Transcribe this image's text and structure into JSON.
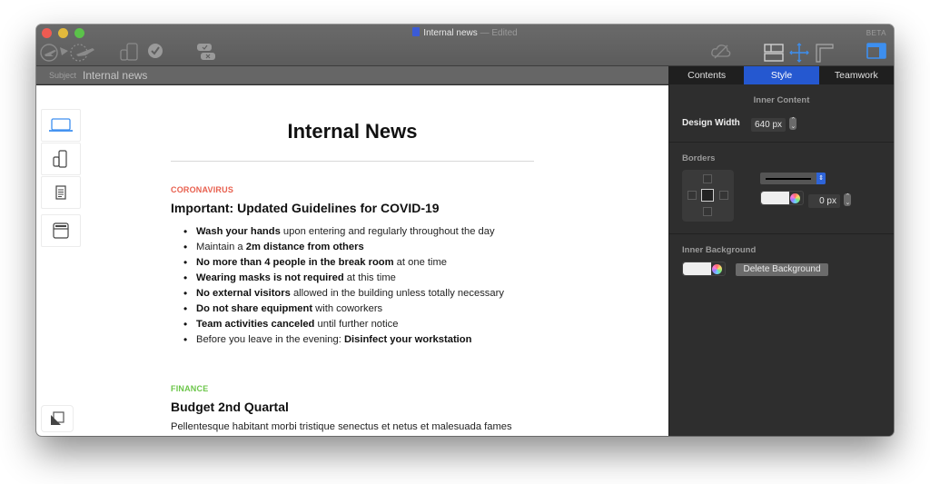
{
  "window": {
    "title": "Internal news",
    "title_status": "— Edited",
    "beta_label": "BETA"
  },
  "toolbar": {
    "left_icons": [
      "send-plane-icon",
      "schedule-plane-icon",
      "device-preview-icon",
      "check-icon",
      "approve-reject-icon"
    ],
    "right_icons": [
      "cloud-off-icon",
      "layout-blocks-icon",
      "move-icon",
      "ruler-icon",
      "sidebar-panel-icon"
    ]
  },
  "subject": {
    "label": "Subject",
    "value": "Internal news"
  },
  "device_buttons": [
    {
      "name": "desktop-preview",
      "icon": "laptop-icon",
      "active": true
    },
    {
      "name": "mobile-preview",
      "icon": "phone-tablet-icon",
      "active": false
    },
    {
      "name": "text-preview",
      "icon": "document-icon",
      "active": false
    },
    {
      "name": "inbox-preview",
      "icon": "inbox-window-icon",
      "active": false
    }
  ],
  "bottom_button_icon": "layers-icon",
  "document": {
    "title": "Internal News",
    "sections": [
      {
        "category": "CORONAVIRUS",
        "category_color": "#e8604f",
        "headline": "Important: Updated Guidelines for COVID-19",
        "bullets": [
          {
            "bold": "Wash your hands",
            "rest": " upon entering and regularly throughout the day",
            "pre": ""
          },
          {
            "pre": "Maintain a ",
            "bold": "2m distance from others",
            "rest": ""
          },
          {
            "bold": "No more than 4 people in the break room",
            "rest": " at one time",
            "pre": ""
          },
          {
            "bold": "Wearing masks is not required",
            "rest": " at this time",
            "pre": ""
          },
          {
            "bold": "No external visitors",
            "rest": " allowed in the building unless totally necessary",
            "pre": ""
          },
          {
            "bold": "Do not share equipment",
            "rest": " with coworkers",
            "pre": ""
          },
          {
            "bold": "Team activities canceled",
            "rest": " until further notice",
            "pre": ""
          },
          {
            "pre": "Before you leave in the evening: ",
            "bold": "Disinfect your workstation",
            "rest": ""
          }
        ]
      },
      {
        "category": "FINANCE",
        "category_color": "#6cc64a",
        "headline": "Budget 2nd Quartal",
        "paragraph": "Pellentesque habitant morbi tristique senectus et netus et malesuada fames"
      }
    ]
  },
  "panel": {
    "tabs": [
      {
        "label": "Contents",
        "active": false
      },
      {
        "label": "Style",
        "active": true
      },
      {
        "label": "Teamwork",
        "active": false
      }
    ],
    "inner_content": {
      "title": "Inner Content",
      "design_width_label": "Design Width",
      "design_width_value": "640 px"
    },
    "borders": {
      "title": "Borders",
      "style": "solid",
      "color": "#efefef",
      "width_value": "0 px"
    },
    "inner_background": {
      "title": "Inner Background",
      "color": "#efefef",
      "delete_label": "Delete Background"
    }
  },
  "colors": {
    "accent": "#2558d0"
  }
}
